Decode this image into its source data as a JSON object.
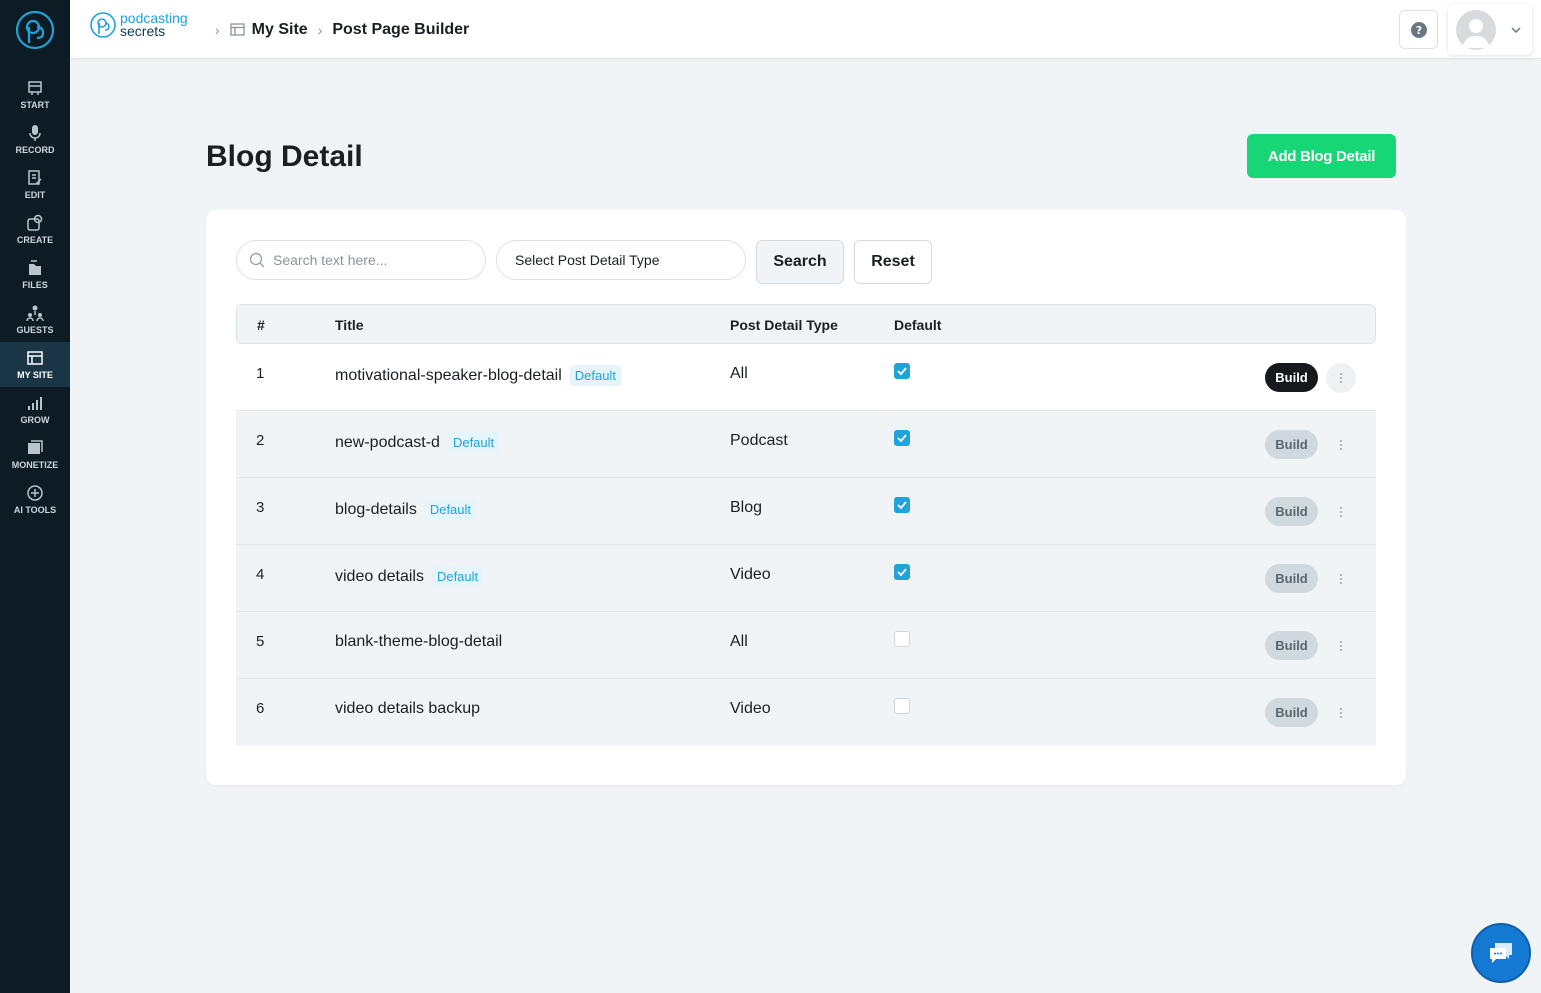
{
  "sidebar": {
    "items": [
      {
        "label": "START"
      },
      {
        "label": "RECORD"
      },
      {
        "label": "EDIT"
      },
      {
        "label": "CREATE"
      },
      {
        "label": "FILES"
      },
      {
        "label": "GUESTS"
      },
      {
        "label": "MY SITE"
      },
      {
        "label": "GROW"
      },
      {
        "label": "MONETIZE"
      },
      {
        "label": "AI TOOLS"
      }
    ]
  },
  "topbar": {
    "brand_line1": "podcasting",
    "brand_line2": "secrets",
    "breadcrumb": [
      "My Site",
      "Post Page Builder"
    ]
  },
  "main": {
    "title": "Blog Detail",
    "add_label": "Add Blog Detail",
    "search_placeholder": "Search text here...",
    "select_label": "Select Post Detail Type",
    "search_label": "Search",
    "reset_label": "Reset"
  },
  "table": {
    "headers": [
      "#",
      "Title",
      "Post Detail Type",
      "Default"
    ],
    "build_label": "Build",
    "default_tag": "Default",
    "rows": [
      {
        "num": "1",
        "title": "motivational-speaker-blog-detail",
        "tag": "Default",
        "type": "All",
        "checked": true
      },
      {
        "num": "2",
        "title": "new-podcast-d",
        "tag": "Default",
        "type": "Podcast",
        "checked": true
      },
      {
        "num": "3",
        "title": "blog-details",
        "tag": "Default",
        "type": "Blog",
        "checked": true
      },
      {
        "num": "4",
        "title": "video details",
        "tag": "Default",
        "type": "Video",
        "checked": true
      },
      {
        "num": "5",
        "title": "blank-theme-blog-detail",
        "tag": "",
        "type": "All",
        "checked": false
      },
      {
        "num": "6",
        "title": "video details backup",
        "tag": "",
        "type": "Video",
        "checked": false
      }
    ]
  },
  "colors": {
    "accent": "#1fa3d8",
    "primary_button": "#17d676",
    "sidebar_bg": "#0d1b24"
  }
}
